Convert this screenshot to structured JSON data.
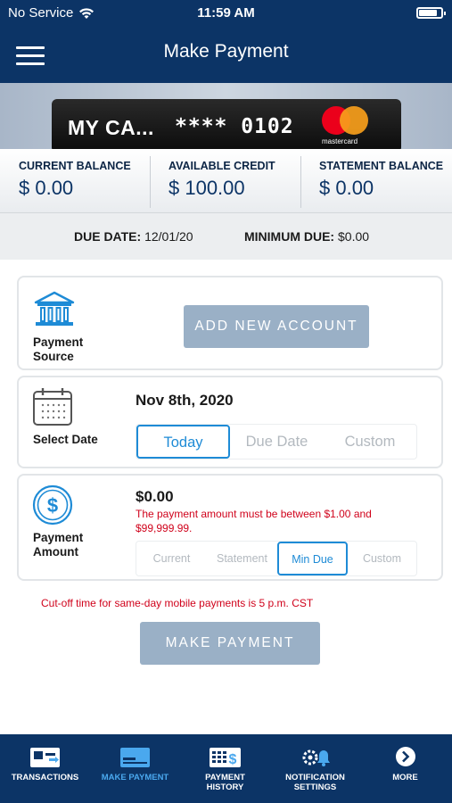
{
  "status_bar": {
    "carrier": "No Service",
    "time": "11:59 AM"
  },
  "header": {
    "title": "Make Payment"
  },
  "card": {
    "name": "MY CA...",
    "number_masked": "**** 0102",
    "network": "mastercard"
  },
  "balances": [
    {
      "label": "CURRENT BALANCE",
      "value": "$ 0.00"
    },
    {
      "label": "AVAILABLE CREDIT",
      "value": "$ 100.00"
    },
    {
      "label": "STATEMENT BALANCE",
      "value": "$ 0.00"
    }
  ],
  "due": {
    "due_date_label": "DUE DATE:",
    "due_date_value": "12/01/20",
    "min_due_label": "MINIMUM DUE:",
    "min_due_value": "$0.00"
  },
  "payment_source": {
    "label_line1": "Payment",
    "label_line2": "Source",
    "button": "ADD NEW ACCOUNT",
    "icon": "bank-icon"
  },
  "select_date": {
    "label": "Select Date",
    "date": "Nov 8th, 2020",
    "icon": "calendar-icon",
    "options": [
      "Today",
      "Due Date",
      "Custom"
    ],
    "selected": "Today"
  },
  "payment_amount": {
    "label_line1": "Payment",
    "label_line2": "Amount",
    "icon": "dollar-icon",
    "amount": "$0.00",
    "error": "The payment amount must be between $1.00 and $99,999.99.",
    "options": [
      "Current",
      "Statement",
      "Min Due",
      "Custom"
    ],
    "selected": "Min Due"
  },
  "cutoff_note": "Cut-off time for same-day mobile payments is 5 p.m. CST",
  "make_payment_button": "MAKE PAYMENT",
  "tabbar": [
    {
      "label_line1": "TRANSACTIONS",
      "label_line2": "",
      "icon": "transactions-icon"
    },
    {
      "label_line1": "MAKE PAYMENT",
      "label_line2": "",
      "icon": "make-payment-icon",
      "active": true
    },
    {
      "label_line1": "PAYMENT",
      "label_line2": "HISTORY",
      "icon": "payment-history-icon"
    },
    {
      "label_line1": "NOTIFICATION",
      "label_line2": "SETTINGS",
      "icon": "notification-settings-icon"
    },
    {
      "label_line1": "MORE",
      "label_line2": "",
      "icon": "more-icon"
    }
  ],
  "colors": {
    "navy": "#0c3466",
    "accent_blue": "#1e8bd6",
    "button_gray_blue": "#9ab0c6",
    "error_red": "#d0021b"
  }
}
